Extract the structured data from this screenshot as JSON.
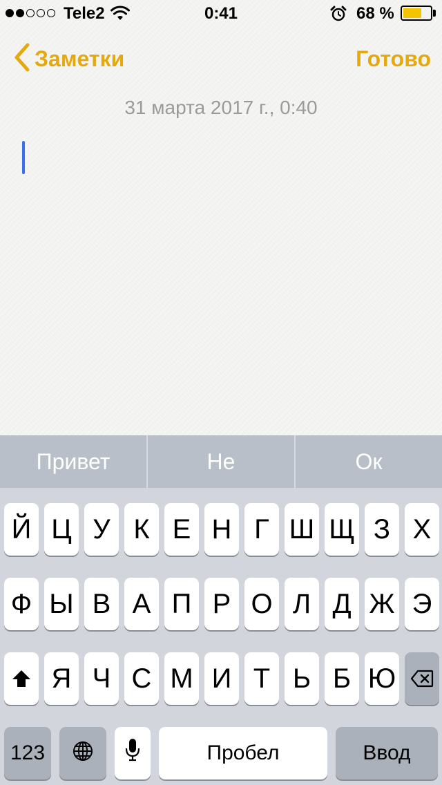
{
  "status_bar": {
    "carrier": "Tele2",
    "signal_bars_filled": 2,
    "signal_bars_total": 5,
    "time": "0:41",
    "battery_percent_label": "68 %",
    "battery_level": 0.68,
    "battery_color": "#f5c400"
  },
  "nav": {
    "back_label": "Заметки",
    "done_label": "Готово",
    "accent_color": "#e4a90e"
  },
  "note": {
    "date": "31 марта 2017 г., 0:40",
    "text": ""
  },
  "suggestions": [
    "Привет",
    "Не",
    "Ок"
  ],
  "keyboard": {
    "row1": [
      "Й",
      "Ц",
      "У",
      "К",
      "Е",
      "Н",
      "Г",
      "Ш",
      "Щ",
      "З",
      "Х"
    ],
    "row2": [
      "Ф",
      "Ы",
      "В",
      "А",
      "П",
      "Р",
      "О",
      "Л",
      "Д",
      "Ж",
      "Э"
    ],
    "row3": [
      "Я",
      "Ч",
      "С",
      "М",
      "И",
      "Т",
      "Ь",
      "Б",
      "Ю"
    ],
    "numbers_label": "123",
    "space_label": "Пробел",
    "return_label": "Ввод",
    "icons": [
      "shift-icon",
      "backspace-icon",
      "globe-icon",
      "microphone-icon"
    ]
  }
}
